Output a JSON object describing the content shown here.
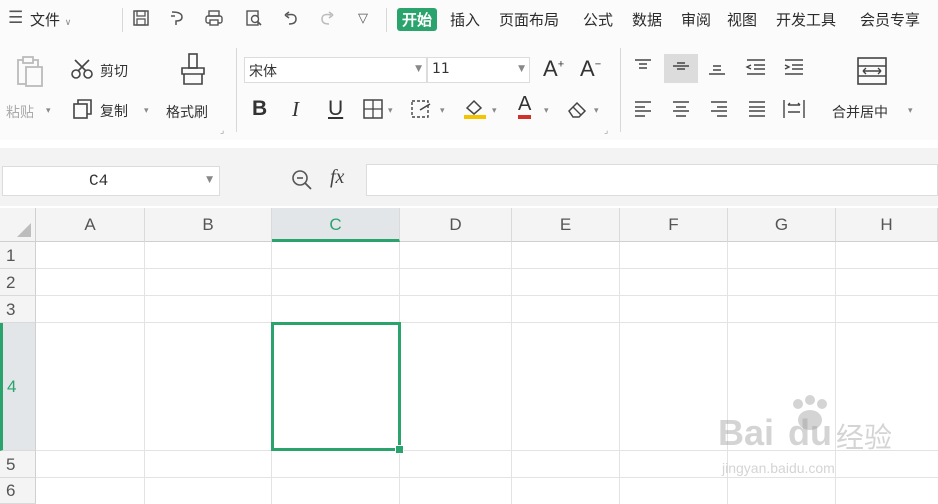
{
  "menubar": {
    "hamburger_icon": "menu-icon",
    "file_label": "文件",
    "tabs": [
      "开始",
      "插入",
      "页面布局",
      "公式",
      "数据",
      "审阅",
      "视图",
      "开发工具",
      "会员专享"
    ],
    "active_tab": "开始",
    "accent_color": "#2ba36d"
  },
  "ribbon": {
    "paste_label": "粘贴",
    "cut_label": "剪切",
    "copy_label": "复制",
    "format_painter_label": "格式刷",
    "font_name": "宋体",
    "font_size": "11",
    "merge_label": "合并居中",
    "grow_font": "A",
    "shrink_font": "A",
    "bold": "B",
    "italic": "I",
    "underline": "U",
    "font_color_glyph": "A"
  },
  "formulabar": {
    "name_box": "C4",
    "fx_label": "fx",
    "formula_value": ""
  },
  "sheet": {
    "columns": [
      "A",
      "B",
      "C",
      "D",
      "E",
      "F",
      "G",
      "H"
    ],
    "rows": [
      "1",
      "2",
      "3",
      "4",
      "5",
      "6"
    ],
    "selected_cell": "C4",
    "selected_column": "C",
    "selected_row": "4"
  },
  "watermark": {
    "brand": "Bai",
    "brand2": "du",
    "brand_cn": "经验",
    "url": "jingyan.baidu.com"
  }
}
